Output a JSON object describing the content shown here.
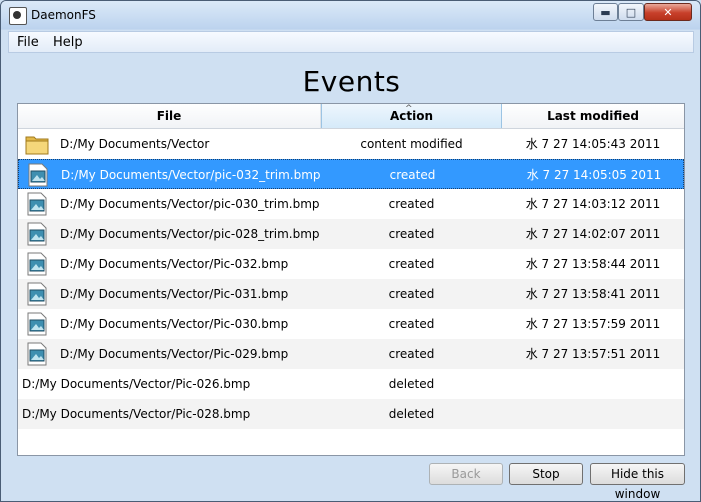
{
  "window": {
    "title": "DaemonFS"
  },
  "menu": {
    "file": "File",
    "help": "Help"
  },
  "heading": "Events",
  "columns": {
    "file": "File",
    "action": "Action",
    "modified": "Last modified"
  },
  "rows": [
    {
      "icon": "folder",
      "file": "D:/My Documents/Vector",
      "action": "content modified",
      "modified": "水 7 27 14:05:43 2011"
    },
    {
      "icon": "image",
      "file": "D:/My Documents/Vector/pic-032_trim.bmp",
      "action": "created",
      "modified": "水 7 27 14:05:05 2011"
    },
    {
      "icon": "image",
      "file": "D:/My Documents/Vector/pic-030_trim.bmp",
      "action": "created",
      "modified": "水 7 27 14:03:12 2011"
    },
    {
      "icon": "image",
      "file": "D:/My Documents/Vector/pic-028_trim.bmp",
      "action": "created",
      "modified": "水 7 27 14:02:07 2011"
    },
    {
      "icon": "image",
      "file": "D:/My Documents/Vector/Pic-032.bmp",
      "action": "created",
      "modified": "水 7 27 13:58:44 2011"
    },
    {
      "icon": "image",
      "file": "D:/My Documents/Vector/Pic-031.bmp",
      "action": "created",
      "modified": "水 7 27 13:58:41 2011"
    },
    {
      "icon": "image",
      "file": "D:/My Documents/Vector/Pic-030.bmp",
      "action": "created",
      "modified": "水 7 27 13:57:59 2011"
    },
    {
      "icon": "image",
      "file": "D:/My Documents/Vector/Pic-029.bmp",
      "action": "created",
      "modified": "水 7 27 13:57:51 2011"
    },
    {
      "icon": "",
      "file": "D:/My Documents/Vector/Pic-026.bmp",
      "action": "deleted",
      "modified": ""
    },
    {
      "icon": "",
      "file": "D:/My Documents/Vector/Pic-028.bmp",
      "action": "deleted",
      "modified": ""
    }
  ],
  "selected_row": 1,
  "buttons": {
    "back": "Back",
    "stop": "Stop",
    "hide": "Hide this window"
  },
  "colors": {
    "selection": "#3399ff",
    "header_active": "#d6eaf9"
  }
}
